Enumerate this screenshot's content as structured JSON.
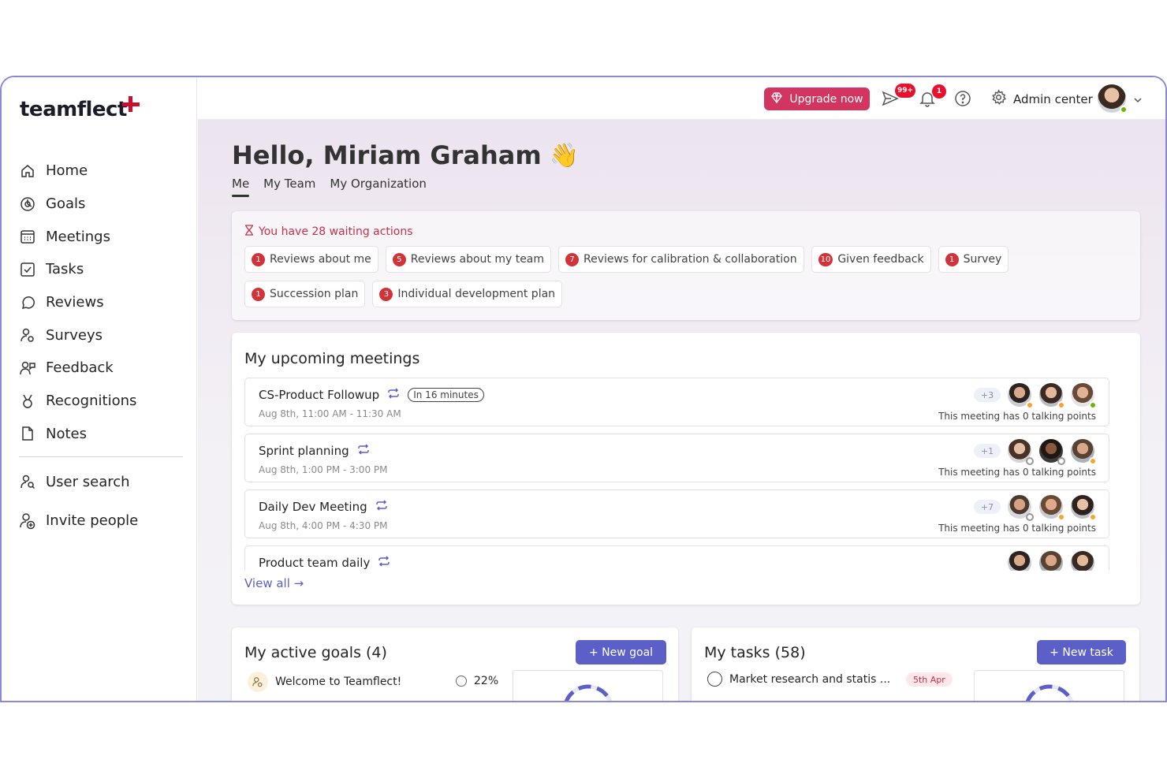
{
  "brand": {
    "name": "teamflect",
    "accent": "#c8102e",
    "primary": "#5b5fc7"
  },
  "sidebar": {
    "items": [
      {
        "label": "Home",
        "icon": "home-icon"
      },
      {
        "label": "Goals",
        "icon": "goals-icon"
      },
      {
        "label": "Meetings",
        "icon": "calendar-icon"
      },
      {
        "label": "Tasks",
        "icon": "checkbox-icon"
      },
      {
        "label": "Reviews",
        "icon": "chat-bubble-icon"
      },
      {
        "label": "Surveys",
        "icon": "survey-icon"
      },
      {
        "label": "Feedback",
        "icon": "feedback-icon"
      },
      {
        "label": "Recognitions",
        "icon": "medal-icon"
      },
      {
        "label": "Notes",
        "icon": "note-icon"
      }
    ],
    "secondary": [
      {
        "label": "User search",
        "icon": "user-search-icon"
      },
      {
        "label": "Invite people",
        "icon": "invite-person-icon"
      }
    ]
  },
  "topbar": {
    "upgrade_label": "Upgrade now",
    "send_badge": "99+",
    "bell_badge": "1",
    "admin_label": "Admin center"
  },
  "greeting": {
    "text": "Hello, Miriam Graham",
    "emoji": "👋"
  },
  "tabs": [
    "Me",
    "My Team",
    "My Organization"
  ],
  "waiting": {
    "title": "You have 28 waiting actions",
    "items": [
      {
        "count": "1",
        "label": "Reviews about me"
      },
      {
        "count": "5",
        "label": "Reviews about my team"
      },
      {
        "count": "7",
        "label": "Reviews for calibration & collaboration"
      },
      {
        "count": "10",
        "label": "Given feedback"
      },
      {
        "count": "1",
        "label": "Survey"
      },
      {
        "count": "1",
        "label": "Succession plan"
      },
      {
        "count": "3",
        "label": "Individual development plan"
      }
    ]
  },
  "meetings": {
    "title": "My upcoming meetings",
    "items": [
      {
        "title": "CS-Product Followup",
        "tag": "In 16 minutes",
        "time": "Aug 8th, 11:00 AM - 11:30 AM",
        "extra": "+3",
        "points": "This meeting has 0 talking points"
      },
      {
        "title": "Sprint planning",
        "tag": "",
        "time": "Aug 8th, 1:00 PM - 3:00 PM",
        "extra": "+1",
        "points": "This meeting has 0 talking points"
      },
      {
        "title": "Daily Dev Meeting",
        "tag": "",
        "time": "Aug 8th, 4:00 PM - 4:30 PM",
        "extra": "+7",
        "points": "This meeting has 0 talking points"
      },
      {
        "title": "Product team daily",
        "tag": "",
        "time": "",
        "extra": "",
        "points": ""
      }
    ],
    "view_all": "View all →"
  },
  "goals": {
    "title": "My active goals (4)",
    "new_label": "+ New goal",
    "first": {
      "label": "Welcome to Teamflect!",
      "progress_label": "22%",
      "progress": 0.22
    }
  },
  "tasks": {
    "title": "My tasks (58)",
    "new_label": "+ New task",
    "first": {
      "label": "Market research and statis ...",
      "due": "5th Apr"
    }
  }
}
